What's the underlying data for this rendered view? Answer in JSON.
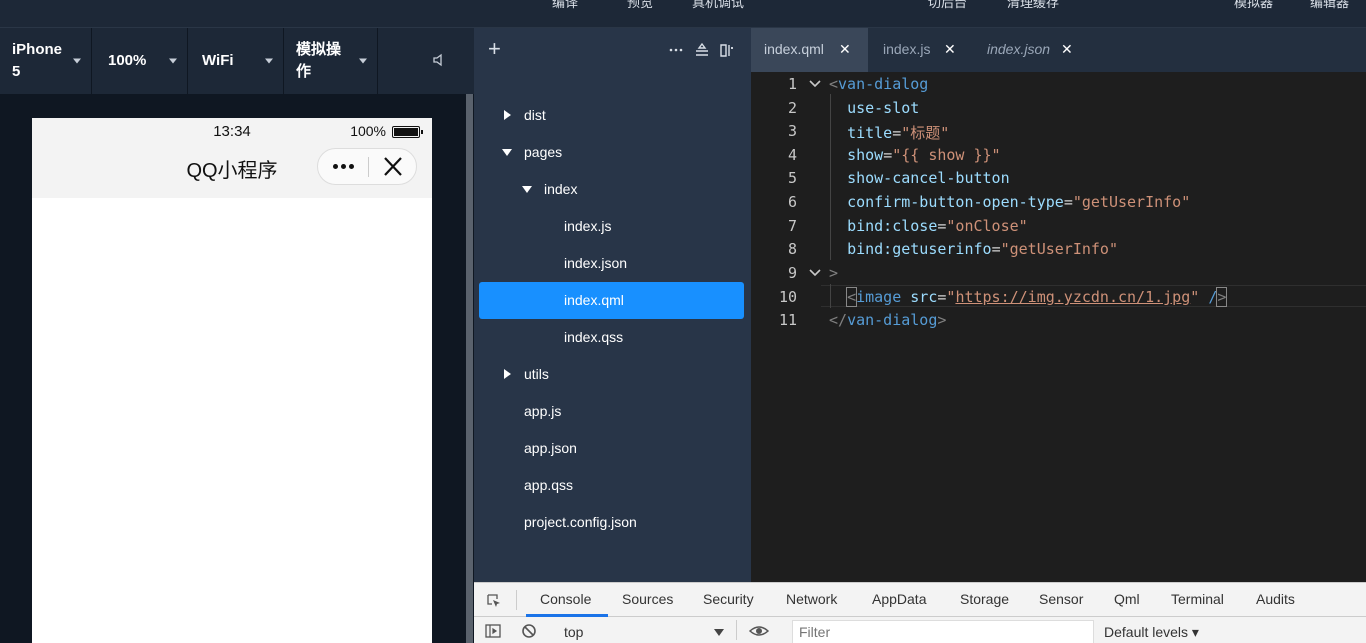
{
  "toolbar": {
    "items": [
      "编译",
      "预览",
      "真机调试",
      "切后台",
      "清理缓存",
      "模拟器",
      "编辑器"
    ]
  },
  "sim_controls": {
    "device": "iPhone 5",
    "zoom": "100%",
    "network": "WiFi",
    "operation": "模拟操作"
  },
  "phone": {
    "time": "13:34",
    "battery_pct": "100%",
    "battery_level": 1.0,
    "app_title": "QQ小程序"
  },
  "file_tree": {
    "items": [
      {
        "label": "dist"
      },
      {
        "label": "pages"
      },
      {
        "label": "index"
      },
      {
        "label": "index.js"
      },
      {
        "label": "index.json"
      },
      {
        "label": "index.qml"
      },
      {
        "label": "index.qss"
      },
      {
        "label": "utils"
      },
      {
        "label": "app.js"
      },
      {
        "label": "app.json"
      },
      {
        "label": "app.qss"
      },
      {
        "label": "project.config.json"
      }
    ],
    "selected": "index.qml"
  },
  "editor": {
    "tabs": [
      {
        "label": "index.qml",
        "active": true
      },
      {
        "label": "index.js",
        "active": false
      },
      {
        "label": "index.json",
        "active": false
      }
    ],
    "line_numbers": [
      "1",
      "2",
      "3",
      "4",
      "5",
      "6",
      "7",
      "8",
      "9",
      "10",
      "11"
    ],
    "code": {
      "l1_tag": "van-dialog",
      "l2_attr": "use-slot",
      "l3_attr": "title",
      "l3_val": "\"标题\"",
      "l4_attr": "show",
      "l4_val": "\"{{ show }}\"",
      "l5_attr": "show-cancel-button",
      "l6_attr": "confirm-button-open-type",
      "l6_val": "\"getUserInfo\"",
      "l7_attr": "bind:close",
      "l7_val": "\"onClose\"",
      "l8_attr": "bind:getuserinfo",
      "l8_val": "\"getUserInfo\"",
      "l10_tag": "image",
      "l10_attr": "src",
      "l10_url": "https://img.yzcdn.cn/1.jpg",
      "l11_tag": "van-dialog"
    }
  },
  "devtools": {
    "tabs": [
      "Console",
      "Sources",
      "Security",
      "Network",
      "AppData",
      "Storage",
      "Sensor",
      "Qml",
      "Terminal",
      "Audits"
    ],
    "active_tab": "Console",
    "context": "top",
    "filter_placeholder": "Filter",
    "levels": "Default levels ▾"
  },
  "colors": {
    "accent": "#1890ff",
    "tree_bg": "#283548",
    "editor_bg": "#1e1e1e"
  }
}
